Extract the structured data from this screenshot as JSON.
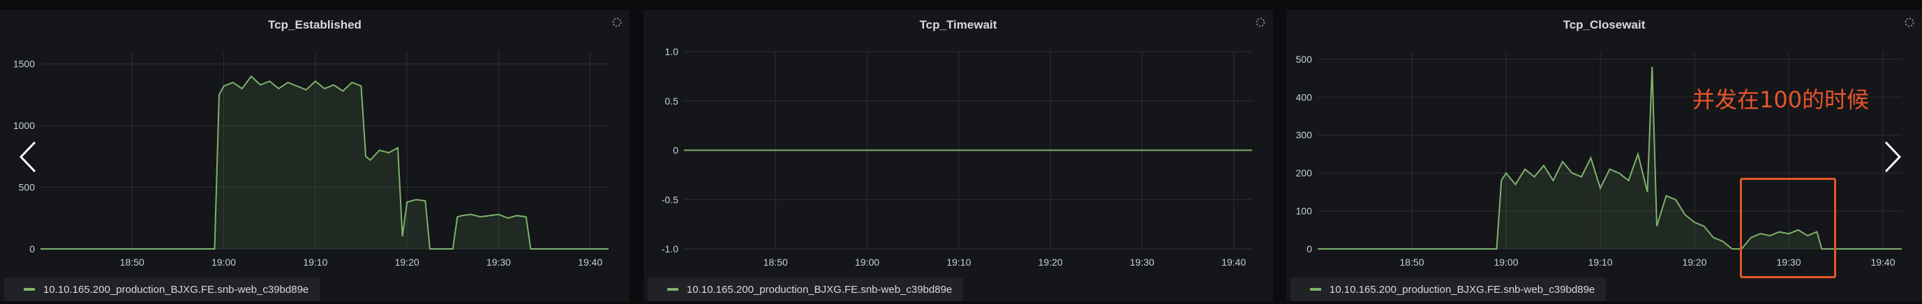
{
  "panels": [
    {
      "title": "Tcp_Established",
      "legend": "10.10.165.200_production_BJXG.FE.snb-web_c39bd89e"
    },
    {
      "title": "Tcp_Timewait",
      "legend": "10.10.165.200_production_BJXG.FE.snb-web_c39bd89e"
    },
    {
      "title": "Tcp_Closewait",
      "legend": "10.10.165.200_production_BJXG.FE.snb-web_c39bd89e"
    }
  ],
  "annotation": {
    "text": "并发在100的时候"
  },
  "colors": {
    "series": "#7eb26d",
    "annotation": "#e8542a",
    "panel_bg": "#141619",
    "grid": "#2c2f34"
  },
  "chart_data": [
    {
      "type": "line",
      "title": "Tcp_Established",
      "xlim": [
        18.4,
        19.42
      ],
      "ylim": [
        0,
        1600
      ],
      "x_ticks": [
        "18:50",
        "19:00",
        "19:10",
        "19:20",
        "19:30",
        "19:40"
      ],
      "y_ticks": [
        "0",
        "500",
        "1000",
        "1500"
      ],
      "grid": true,
      "legend_position": "bottom-left",
      "series": [
        {
          "name": "10.10.165.200_production_BJXG.FE.snb-web_c39bd89e",
          "x": [
            "18:40",
            "18:59",
            "18:59.5",
            "19:00",
            "19:01",
            "19:02",
            "19:03",
            "19:04",
            "19:05",
            "19:06",
            "19:07",
            "19:08",
            "19:09",
            "19:10",
            "19:11",
            "19:12",
            "19:13",
            "19:14",
            "19:15",
            "19:15.5",
            "19:16",
            "19:17",
            "19:18",
            "19:19",
            "19:19.5",
            "19:20",
            "19:21",
            "19:22",
            "19:22.5",
            "19:25",
            "19:25.5",
            "19:26",
            "19:27",
            "19:28",
            "19:29",
            "19:30",
            "19:31",
            "19:32",
            "19:33",
            "19:33.5",
            "19:42"
          ],
          "y": [
            0,
            0,
            1250,
            1320,
            1350,
            1300,
            1400,
            1330,
            1360,
            1300,
            1350,
            1320,
            1290,
            1360,
            1300,
            1330,
            1280,
            1350,
            1320,
            750,
            720,
            800,
            780,
            820,
            100,
            380,
            400,
            390,
            0,
            0,
            260,
            270,
            280,
            260,
            270,
            280,
            250,
            270,
            260,
            0,
            0
          ]
        }
      ]
    },
    {
      "type": "line",
      "title": "Tcp_Timewait",
      "xlim": [
        18.4,
        19.42
      ],
      "ylim": [
        -1.0,
        1.0
      ],
      "x_ticks": [
        "18:50",
        "19:00",
        "19:10",
        "19:20",
        "19:30",
        "19:40"
      ],
      "y_ticks": [
        "1.0",
        "0.5",
        "0",
        "-0.5",
        "-1.0"
      ],
      "grid": true,
      "legend_position": "bottom-left",
      "series": [
        {
          "name": "10.10.165.200_production_BJXG.FE.snb-web_c39bd89e",
          "x": [
            "18:40",
            "19:42"
          ],
          "y": [
            0,
            0
          ]
        }
      ]
    },
    {
      "type": "line",
      "title": "Tcp_Closewait",
      "xlim": [
        18.4,
        19.42
      ],
      "ylim": [
        0,
        520
      ],
      "x_ticks": [
        "18:50",
        "19:00",
        "19:10",
        "19:20",
        "19:30",
        "19:40"
      ],
      "y_ticks": [
        "0",
        "100",
        "200",
        "300",
        "400",
        "500"
      ],
      "grid": true,
      "legend_position": "bottom-left",
      "series": [
        {
          "name": "10.10.165.200_production_BJXG.FE.snb-web_c39bd89e",
          "x": [
            "18:40",
            "18:59",
            "18:59.5",
            "19:00",
            "19:01",
            "19:02",
            "19:03",
            "19:04",
            "19:05",
            "19:06",
            "19:07",
            "19:08",
            "19:09",
            "19:10",
            "19:11",
            "19:12",
            "19:13",
            "19:14",
            "19:15",
            "19:15.5",
            "19:16",
            "19:17",
            "19:18",
            "19:19",
            "19:20",
            "19:21",
            "19:22",
            "19:23",
            "19:24",
            "19:25",
            "19:26",
            "19:27",
            "19:28",
            "19:29",
            "19:30",
            "19:31",
            "19:32",
            "19:33",
            "19:33.5",
            "19:42"
          ],
          "y": [
            0,
            0,
            180,
            200,
            170,
            210,
            190,
            220,
            180,
            230,
            200,
            190,
            240,
            160,
            210,
            200,
            180,
            250,
            150,
            480,
            60,
            140,
            130,
            90,
            70,
            60,
            30,
            20,
            0,
            0,
            30,
            40,
            35,
            45,
            40,
            50,
            35,
            45,
            0,
            0
          ]
        }
      ]
    }
  ]
}
